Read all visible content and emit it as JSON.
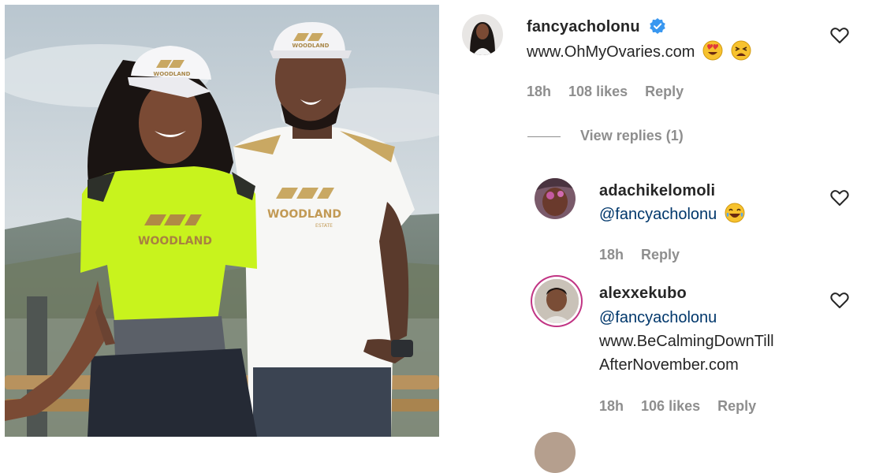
{
  "photo": {
    "cap_brand": "WOODLAND",
    "shirt_brand_left": "WOODLAND",
    "shirt_brand_right": "WOODLAND",
    "shirt_sub": "ESTATE"
  },
  "comments": [
    {
      "username": "fancyacholonu",
      "verified": true,
      "text": "www.OhMyOvaries.com",
      "emojis": [
        "heart-eyes-emoji",
        "tired-face-emoji"
      ],
      "time": "18h",
      "likes": "108 likes",
      "reply": "Reply",
      "view_replies": "View replies (1)"
    },
    {
      "username": "adachikelomoli",
      "mention": "@fancyacholonu",
      "emojis": [
        "laughing-emoji"
      ],
      "time": "18h",
      "reply": "Reply"
    },
    {
      "username": "alexxekubo",
      "mention": "@fancyacholonu",
      "text_line1": "www.BeCalmingDownTill",
      "text_line2": "AfterNovember.com",
      "time": "18h",
      "likes": "106 likes",
      "reply": "Reply"
    }
  ],
  "colors": {
    "username": "#262626",
    "meta": "#8e8e8e",
    "mention": "#00376b",
    "verified": "#3897f0",
    "story_ring": "#c13584"
  }
}
